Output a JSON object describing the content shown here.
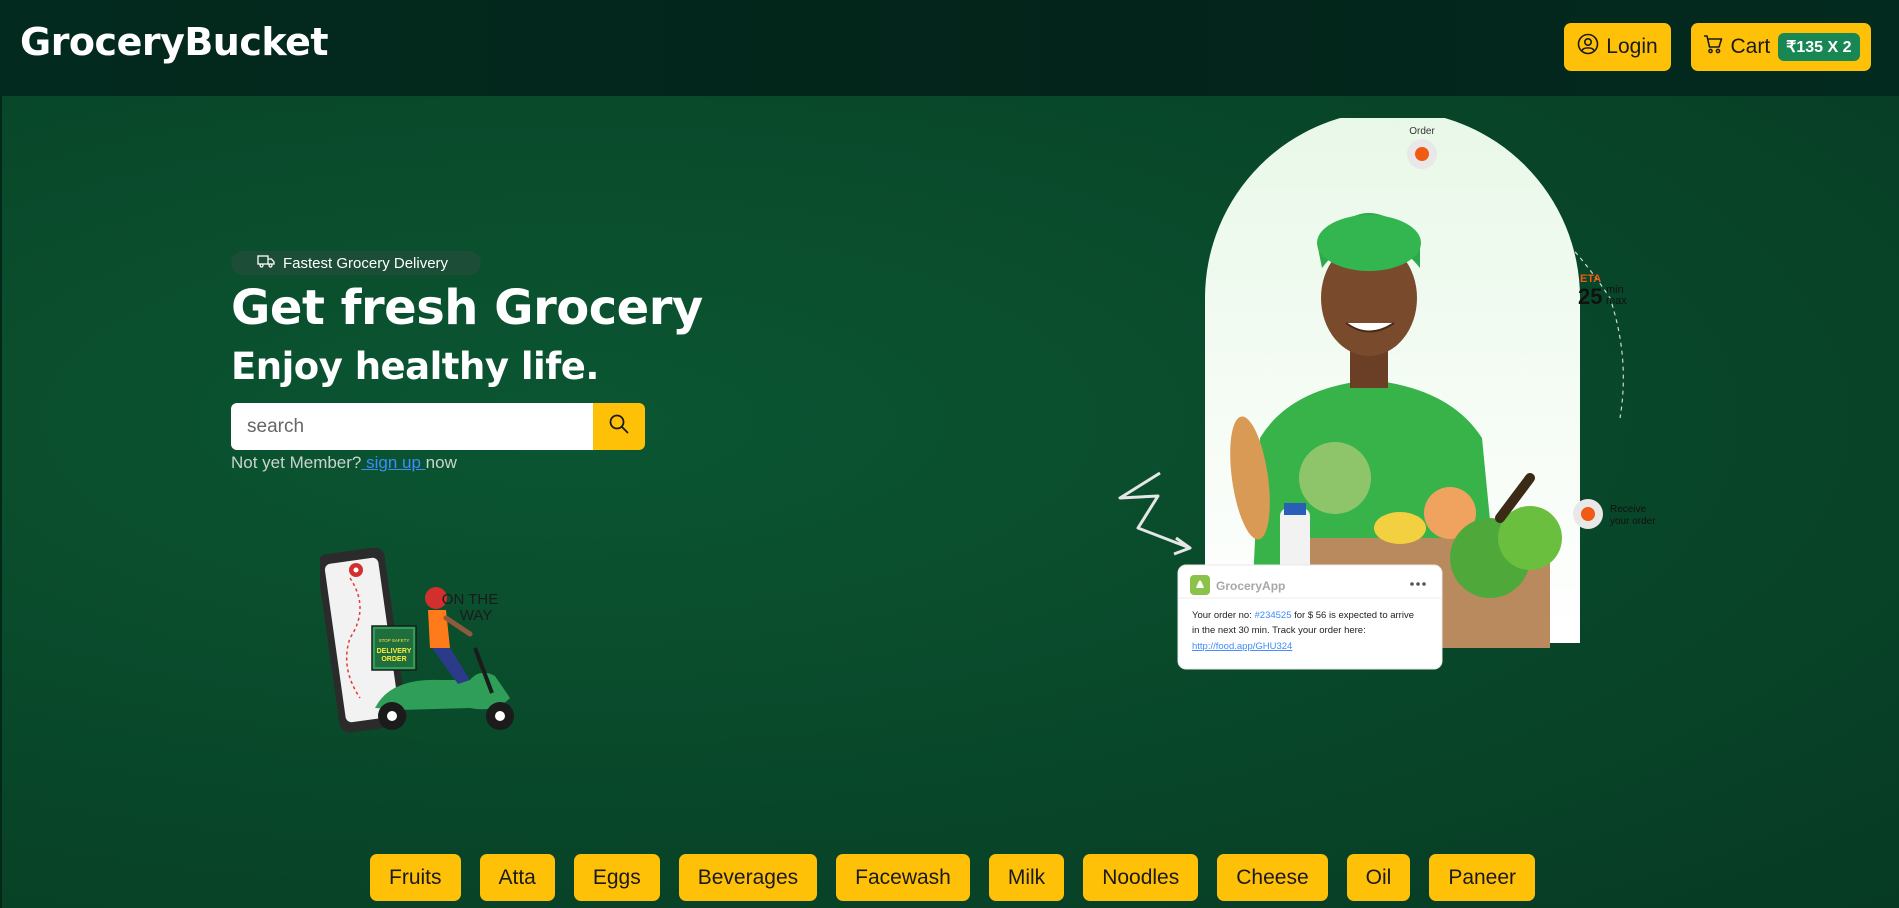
{
  "header": {
    "brand": "GroceryBucket",
    "login_label": "Login",
    "cart_label": "Cart",
    "cart_badge": "₹135 X 2"
  },
  "hero": {
    "pill_text": "Fastest Grocery Delivery",
    "title": "Get fresh Grocery",
    "subtitle": "Enjoy healthy life.",
    "search_placeholder": "search",
    "member_prefix": "Not yet Member?",
    "signup_link": " sign up ",
    "member_suffix": "now"
  },
  "illustration": {
    "order_label": "Order",
    "eta_label": "ETA",
    "eta_value": "25",
    "eta_unit_top": "min",
    "eta_unit_bottom": "max",
    "receive_line1": "Receive",
    "receive_line2": "your order",
    "app_name": "GroceryApp",
    "notification_line1_pre": "Your order no: ",
    "notification_order_no": "#234525",
    "notification_line1_post": " for $ 56  is expected to arrive",
    "notification_line2": " in the next 30 min. Track your order here:",
    "notification_link": "http://food.app/GHU324",
    "scooter_text_1": "ON THE",
    "scooter_text_2": "WAY",
    "scooter_box_1": "STOP SAFETY",
    "scooter_box_2": "DELIVERY",
    "scooter_box_3": "ORDER"
  },
  "categories": [
    "Fruits",
    "Atta",
    "Eggs",
    "Beverages",
    "Facewash",
    "Milk",
    "Noodles",
    "Cheese",
    "Oil",
    "Paneer"
  ],
  "colors": {
    "accent": "#ffc107",
    "header_bg": "#032a1e",
    "hero_bg": "#0a4d2e",
    "badge": "#198754",
    "link": "#3d8bfd"
  }
}
